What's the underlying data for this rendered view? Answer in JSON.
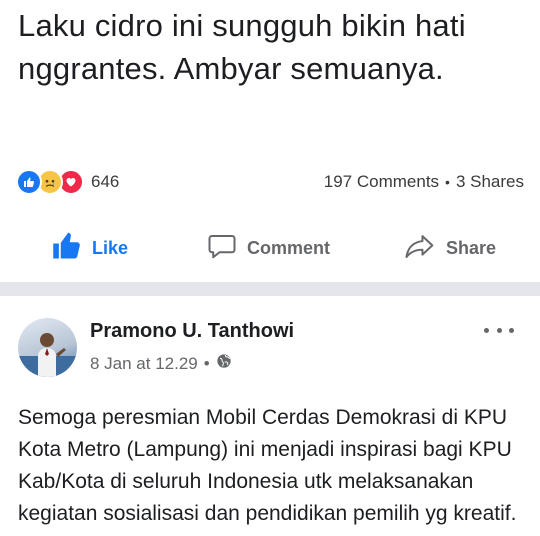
{
  "post1": {
    "text": "Laku cidro ini sungguh bikin hati nggrantes. Ambyar semuanya.",
    "reactions": {
      "icons": [
        "like-reaction",
        "sad-reaction",
        "love-reaction"
      ],
      "count": "646"
    },
    "comments": "197 Comments",
    "separator": "•",
    "shares": "3 Shares",
    "actions": {
      "like": "Like",
      "comment": "Comment",
      "share": "Share"
    },
    "colors": {
      "like_active": "#1877f2",
      "muted": "#65676b"
    }
  },
  "post2": {
    "author": "Pramono U. Tanthowi",
    "date": "8 Jan at 12.29",
    "separator": "•",
    "privacy_icon": "globe-icon",
    "text": "Semoga peresmian Mobil Cerdas Demokrasi di KPU Kota Metro (Lampung) ini menjadi inspirasi bagi KPU Kab/Kota di seluruh Indonesia utk melaksanakan kegiatan sosialisasi dan pendidikan pemilih yg kreatif."
  }
}
